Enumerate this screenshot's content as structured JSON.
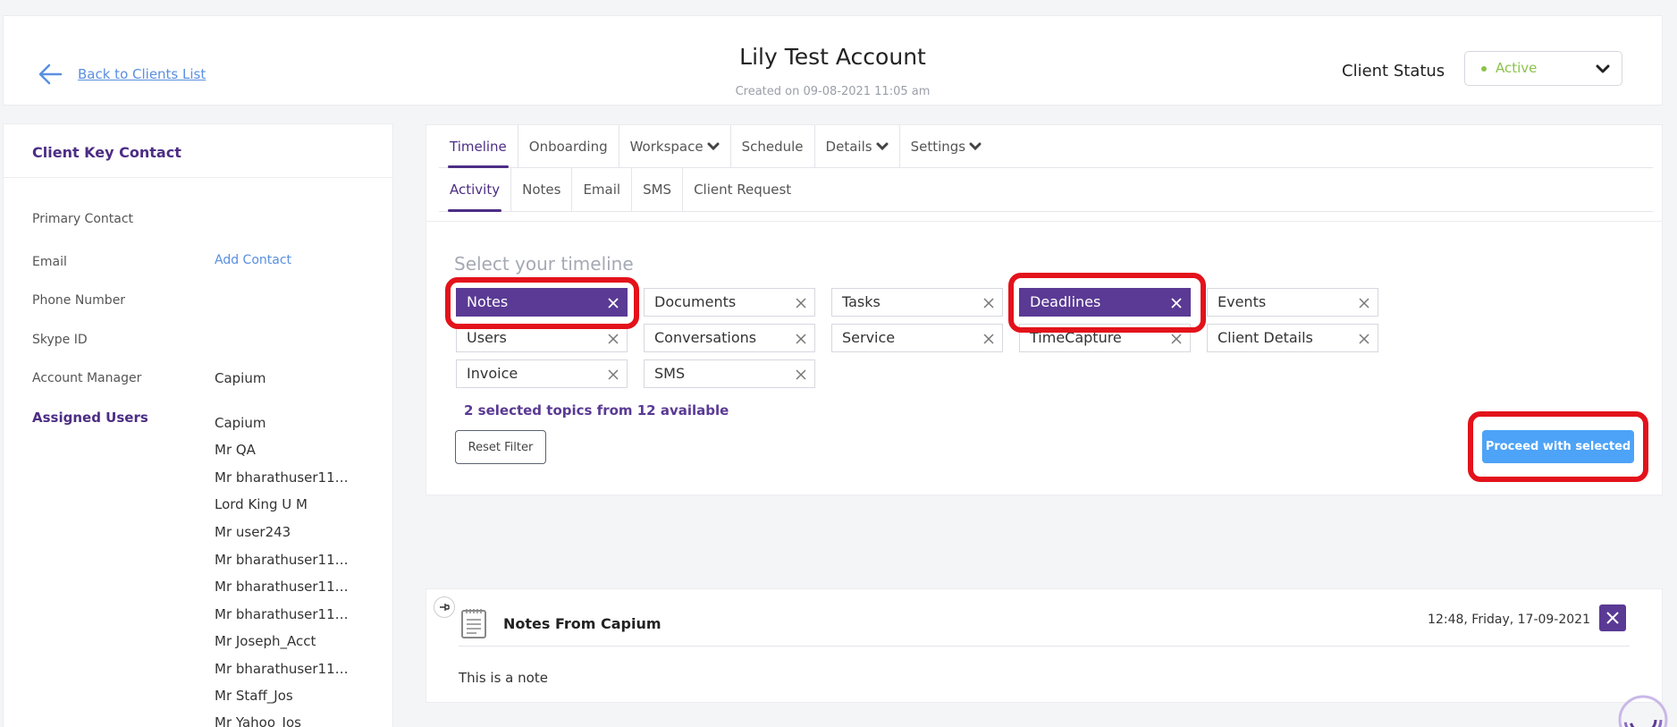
{
  "header": {
    "back_label": "Back to Clients List",
    "account_name": "Lily Test Account",
    "created_on": "Created on 09-08-2021 11:05 am",
    "status_label": "Client Status",
    "status_value": "Active",
    "status_color": "#8bc34a"
  },
  "sidebar": {
    "title": "Client Key Contact",
    "primary_contact": "Primary Contact",
    "email": "Email",
    "add_contact": "Add Contact",
    "phone": "Phone Number",
    "skype": "Skype ID",
    "account_manager": "Account Manager",
    "account_manager_value": "Capium",
    "assigned_users": "Assigned Users",
    "users": [
      "Capium",
      "Mr QA",
      "Mr bharathuser11…",
      "Lord King U M",
      "Mr user243",
      "Mr bharathuser11…",
      "Mr bharathuser11…",
      "Mr bharathuser11…",
      "Mr Joseph_Acct",
      "Mr bharathuser11…",
      "Mr Staff_Jos",
      "Mr Yahoo_Jos"
    ]
  },
  "tabs": {
    "top": [
      "Timeline",
      "Onboarding",
      "Workspace",
      "Schedule",
      "Details",
      "Settings"
    ],
    "sub": [
      "Activity",
      "Notes",
      "Email",
      "SMS",
      "Client Request"
    ]
  },
  "filter": {
    "title": "Select your timeline",
    "topics": [
      "Notes",
      "Documents",
      "Tasks",
      "Deadlines",
      "Events",
      "Users",
      "Conversations",
      "Service",
      "TimeCapture",
      "Client Details",
      "Invoice",
      "SMS"
    ],
    "selected_text": "2 selected topics from 12 available",
    "reset_label": "Reset Filter",
    "proceed_label": "Proceed with selected"
  },
  "note": {
    "title": "Notes From Capium",
    "time": "12:48, Friday, 17-09-2021",
    "body": "This is a note"
  },
  "colors": {
    "accent": "#4c2d84",
    "chip_selected": "#5a3a94",
    "primary_button": "#4da3f7",
    "highlight": "#e3121b",
    "link": "#5a8fe0"
  }
}
